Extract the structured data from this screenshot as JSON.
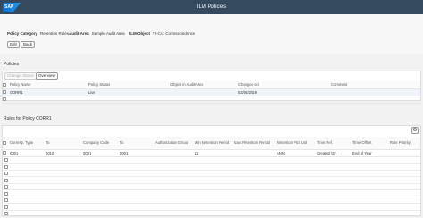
{
  "shell": {
    "logo": "SAP",
    "title": "ILM Policies"
  },
  "header": {
    "policy_category_label": "Policy Category",
    "policy_category_value": "Retention Rules",
    "audit_area_label": "Audit Area",
    "audit_area_value": "Sample Audit Area",
    "ilm_object_label": "ILM Object",
    "ilm_object_value": "FI-CA: Correspondence"
  },
  "toolbar": {
    "edit_label": "Edit",
    "back_label": "Back"
  },
  "policies": {
    "title": "Policies",
    "change_status_label": "Change Status",
    "overview_label": "Overview",
    "columns": [
      "Policy Name",
      "Policy Status",
      "Object in Audit Area",
      "Changed on",
      "Comment"
    ],
    "rows": [
      [
        "CORR1",
        "Live",
        "",
        "02/06/2019",
        ""
      ]
    ]
  },
  "rules": {
    "title": "Rules for Policy CORR1",
    "columns": [
      "Corresp. Type",
      "To",
      "Company Code",
      "To",
      "Authorization Group",
      "Min Retention Period",
      "Max Retention Period",
      "Retention Prd Unit",
      "Time Ref.",
      "Time Offset",
      "Rule Priority"
    ],
    "rows": [
      [
        "0001",
        "0010",
        "0001",
        "0001",
        "",
        "11",
        "",
        "ANN",
        "Created On",
        "End of Year",
        ""
      ]
    ]
  }
}
